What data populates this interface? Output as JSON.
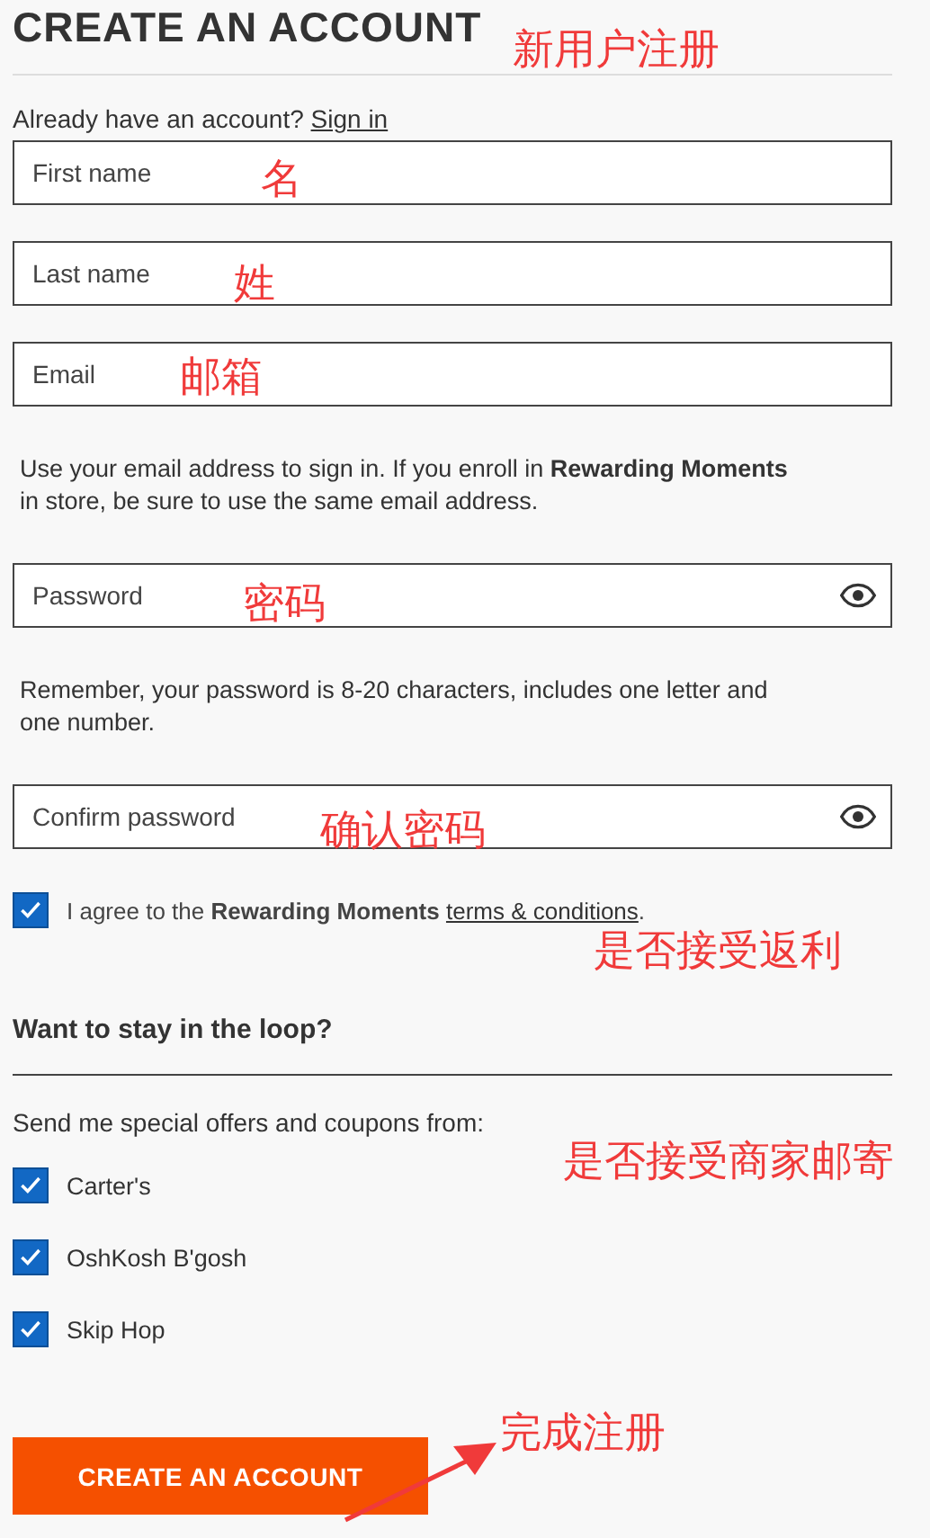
{
  "title": "CREATE AN ACCOUNT",
  "sign_in_prompt": {
    "text": "Already have an account?",
    "link": "Sign in"
  },
  "fields_top": [
    {
      "placeholder": "First name"
    },
    {
      "placeholder": "Last name"
    },
    {
      "placeholder": "Email"
    }
  ],
  "email_note": "Use your email address to sign in. If you enroll in **Rewarding Moments** in store, be sure to use the same email address.",
  "password_field": {
    "placeholder": "Password",
    "kind": "password"
  },
  "password_note": "Remember, your password is 8-20 characters, includes one letter and one number.",
  "confirm_field": {
    "placeholder": "Confirm password",
    "kind": "password"
  },
  "agree": {
    "checked": true,
    "text": "I agree to the **Rewarding Moments** ",
    "link": "terms & conditions",
    "after": "."
  },
  "loop_heading": "Want to stay in the loop?",
  "offers_prompt": "Send me special offers and coupons from:",
  "brands": [
    {
      "label": "Carter's",
      "checked": true
    },
    {
      "label": "OshKosh B'gosh",
      "checked": true
    },
    {
      "label": "Skip Hop",
      "checked": true
    }
  ],
  "submit": "CREATE AN ACCOUNT",
  "annotations": [
    {
      "text": "新用户注册"
    },
    {
      "text": "名"
    },
    {
      "text": "姓"
    },
    {
      "text": "邮箱"
    },
    {
      "text": "密码"
    },
    {
      "text": "确认密码"
    },
    {
      "text": "是否接受返利"
    },
    {
      "text": "是否接受商家邮寄"
    },
    {
      "text": "完成注册"
    }
  ]
}
